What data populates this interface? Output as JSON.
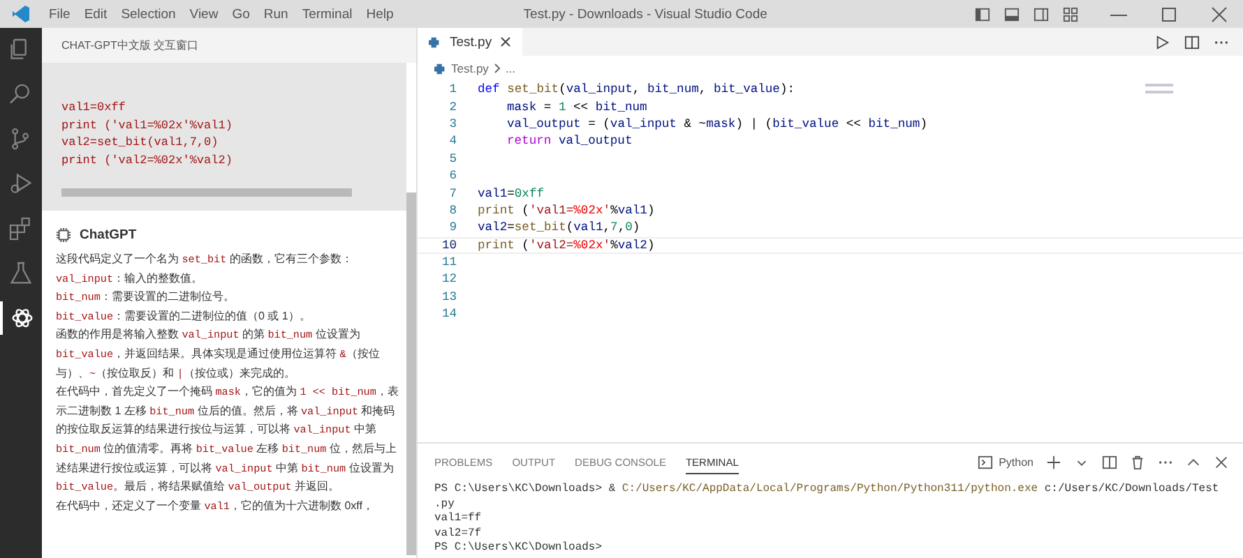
{
  "window": {
    "title": "Test.py - Downloads - Visual Studio Code"
  },
  "menu": [
    "File",
    "Edit",
    "Selection",
    "View",
    "Go",
    "Run",
    "Terminal",
    "Help"
  ],
  "activity_bar": [
    {
      "kind": "files",
      "selected": false
    },
    {
      "kind": "search",
      "selected": false
    },
    {
      "kind": "source-control",
      "selected": false
    },
    {
      "kind": "run",
      "selected": false
    },
    {
      "kind": "extensions",
      "selected": false
    },
    {
      "kind": "flask",
      "selected": false
    },
    {
      "kind": "chat",
      "selected": true
    }
  ],
  "chat_panel": {
    "title": "CHAT-GPT中文版 交互窗口",
    "code_lines": [
      "val1=0xff",
      "print ('val1=%02x'%val1)",
      "val2=set_bit(val1,7,0)",
      "print ('val2=%02x'%val2)"
    ],
    "author": "ChatGPT",
    "paragraphs": [
      [
        {
          "kind": "text",
          "t": "这段代码定义了一个名为 "
        },
        {
          "kind": "code",
          "t": "set_bit"
        },
        {
          "kind": "text",
          "t": " 的函数，它有三个参数："
        }
      ],
      [
        {
          "kind": "code",
          "t": "val_input"
        },
        {
          "kind": "text",
          "t": "：输入的整数值。"
        }
      ],
      [
        {
          "kind": "code",
          "t": "bit_num"
        },
        {
          "kind": "text",
          "t": "：需要设置的二进制位号。"
        }
      ],
      [
        {
          "kind": "code",
          "t": "bit_value"
        },
        {
          "kind": "text",
          "t": "：需要设置的二进制位的值（0 或 1）。"
        }
      ],
      [
        {
          "kind": "text",
          "t": "函数的作用是将输入整数 "
        },
        {
          "kind": "code",
          "t": "val_input"
        },
        {
          "kind": "text",
          "t": " 的第 "
        },
        {
          "kind": "code",
          "t": "bit_num"
        },
        {
          "kind": "text",
          "t": " 位设置为 "
        },
        {
          "kind": "code",
          "t": "bit_value"
        },
        {
          "kind": "text",
          "t": "，并返回结果。具体实现是通过使用位运算符 "
        },
        {
          "kind": "code",
          "t": "&"
        },
        {
          "kind": "text",
          "t": "（按位与）、"
        },
        {
          "kind": "code",
          "t": "~"
        },
        {
          "kind": "text",
          "t": "（按位取反）和 "
        },
        {
          "kind": "code",
          "t": "|"
        },
        {
          "kind": "text",
          "t": "（按位或）来完成的。"
        }
      ],
      [
        {
          "kind": "text",
          "t": "在代码中，首先定义了一个掩码 "
        },
        {
          "kind": "code",
          "t": "mask"
        },
        {
          "kind": "text",
          "t": "，它的值为 "
        },
        {
          "kind": "code",
          "t": "1 << bit_num"
        },
        {
          "kind": "text",
          "t": "，表示二进制数 1 左移 "
        },
        {
          "kind": "code",
          "t": "bit_num"
        },
        {
          "kind": "text",
          "t": " 位后的值。然后，将 "
        },
        {
          "kind": "code",
          "t": "val_input"
        },
        {
          "kind": "text",
          "t": " 和掩码的按位取反运算的结果进行按位与运算，可以将 "
        },
        {
          "kind": "code",
          "t": "val_input"
        },
        {
          "kind": "text",
          "t": " 中第 "
        },
        {
          "kind": "code",
          "t": "bit_num"
        },
        {
          "kind": "text",
          "t": " 位的值清零。再将 "
        },
        {
          "kind": "code",
          "t": "bit_value"
        },
        {
          "kind": "text",
          "t": " 左移 "
        },
        {
          "kind": "code",
          "t": "bit_num"
        },
        {
          "kind": "text",
          "t": " 位，然后与上述结果进行按位或运算，可以将 "
        },
        {
          "kind": "code",
          "t": "val_input"
        },
        {
          "kind": "text",
          "t": " 中第 "
        },
        {
          "kind": "code",
          "t": "bit_num"
        },
        {
          "kind": "text",
          "t": " 位设置为 "
        },
        {
          "kind": "code",
          "t": "bit_value"
        },
        {
          "kind": "text",
          "t": "。最后，将结果赋值给 "
        },
        {
          "kind": "code",
          "t": "val_output"
        },
        {
          "kind": "text",
          "t": " 并返回。"
        }
      ],
      [
        {
          "kind": "text",
          "t": "在代码中，还定义了一个变量 "
        },
        {
          "kind": "code",
          "t": "val1"
        },
        {
          "kind": "text",
          "t": "，它的值为十六进制数 0xff，"
        }
      ]
    ]
  },
  "editor": {
    "tab": {
      "label": "Test.py",
      "selected": true
    },
    "breadcrumb": [
      "Test.py",
      "..."
    ],
    "lines": [
      {
        "number": "1",
        "current": false,
        "tokens": [
          {
            "kind": "kw",
            "t": "def "
          },
          {
            "kind": "fn",
            "t": "set_bit"
          },
          {
            "kind": "op",
            "t": "("
          },
          {
            "kind": "var",
            "t": "val_input"
          },
          {
            "kind": "op",
            "t": ", "
          },
          {
            "kind": "var",
            "t": "bit_num"
          },
          {
            "kind": "op",
            "t": ", "
          },
          {
            "kind": "var",
            "t": "bit_value"
          },
          {
            "kind": "op",
            "t": "):"
          }
        ]
      },
      {
        "number": "2",
        "current": false,
        "indented": true,
        "tokens": [
          {
            "kind": "var",
            "t": "mask"
          },
          {
            "kind": "op",
            "t": " = "
          },
          {
            "kind": "num",
            "t": "1"
          },
          {
            "kind": "op",
            "t": " << "
          },
          {
            "kind": "var",
            "t": "bit_num"
          }
        ]
      },
      {
        "number": "3",
        "current": false,
        "indented": true,
        "tokens": [
          {
            "kind": "var",
            "t": "val_output"
          },
          {
            "kind": "op",
            "t": " = ("
          },
          {
            "kind": "var",
            "t": "val_input"
          },
          {
            "kind": "op",
            "t": " & ~"
          },
          {
            "kind": "var",
            "t": "mask"
          },
          {
            "kind": "op",
            "t": ") | ("
          },
          {
            "kind": "var",
            "t": "bit_value"
          },
          {
            "kind": "op",
            "t": " << "
          },
          {
            "kind": "var",
            "t": "bit_num"
          },
          {
            "kind": "op",
            "t": ")"
          }
        ]
      },
      {
        "number": "4",
        "current": false,
        "indented": true,
        "tokens": [
          {
            "kind": "ctl",
            "t": "return "
          },
          {
            "kind": "var",
            "t": "val_output"
          }
        ]
      },
      {
        "number": "5",
        "current": false
      },
      {
        "number": "6",
        "current": false
      },
      {
        "number": "7",
        "current": false,
        "tokens": [
          {
            "kind": "var",
            "t": "val1"
          },
          {
            "kind": "op",
            "t": "="
          },
          {
            "kind": "num",
            "t": "0xff"
          }
        ]
      },
      {
        "number": "8",
        "current": false,
        "tokens": [
          {
            "kind": "fn",
            "t": "print"
          },
          {
            "kind": "op",
            "t": " ("
          },
          {
            "kind": "str",
            "t": "'val1="
          },
          {
            "kind": "esc",
            "t": "%02x"
          },
          {
            "kind": "str",
            "t": "'"
          },
          {
            "kind": "op",
            "t": "%"
          },
          {
            "kind": "var",
            "t": "val1"
          },
          {
            "kind": "op",
            "t": ")"
          }
        ]
      },
      {
        "number": "9",
        "current": false,
        "tokens": [
          {
            "kind": "var",
            "t": "val2"
          },
          {
            "kind": "op",
            "t": "="
          },
          {
            "kind": "fn",
            "t": "set_bit"
          },
          {
            "kind": "op",
            "t": "("
          },
          {
            "kind": "var",
            "t": "val1"
          },
          {
            "kind": "op",
            "t": ","
          },
          {
            "kind": "num",
            "t": "7"
          },
          {
            "kind": "op",
            "t": ","
          },
          {
            "kind": "num",
            "t": "0"
          },
          {
            "kind": "op",
            "t": ")"
          }
        ]
      },
      {
        "number": "10",
        "current": true,
        "tokens": [
          {
            "kind": "fn",
            "t": "print"
          },
          {
            "kind": "op",
            "t": " ("
          },
          {
            "kind": "str",
            "t": "'val2="
          },
          {
            "kind": "esc",
            "t": "%02x"
          },
          {
            "kind": "str",
            "t": "'"
          },
          {
            "kind": "op",
            "t": "%"
          },
          {
            "kind": "var",
            "t": "val2"
          },
          {
            "kind": "op",
            "t": ")"
          }
        ]
      },
      {
        "number": "11",
        "current": false
      },
      {
        "number": "12",
        "current": false
      },
      {
        "number": "13",
        "current": false
      },
      {
        "number": "14",
        "current": false
      }
    ]
  },
  "panel": {
    "tabs": [
      {
        "label": "PROBLEMS",
        "selected": false
      },
      {
        "label": "OUTPUT",
        "selected": false
      },
      {
        "label": "DEBUG CONSOLE",
        "selected": false
      },
      {
        "label": "TERMINAL",
        "selected": true
      }
    ],
    "terminal_name": "Python",
    "terminal_lines": [
      [
        {
          "kind": "plain",
          "t": "PS C:\\Users\\KC\\Downloads> & "
        },
        {
          "kind": "path",
          "t": "C:/Users/KC/AppData/Local/Programs/Python/Python311/python.exe"
        },
        {
          "kind": "plain",
          "t": " c:/Users/KC/Downloads/Test"
        }
      ],
      [
        {
          "kind": "plain",
          "t": ".py"
        }
      ],
      [
        {
          "kind": "plain",
          "t": "val1=ff"
        }
      ],
      [
        {
          "kind": "plain",
          "t": "val2=7f"
        }
      ],
      [
        {
          "kind": "plain",
          "t": "PS C:\\Users\\KC\\Downloads>"
        }
      ]
    ]
  }
}
